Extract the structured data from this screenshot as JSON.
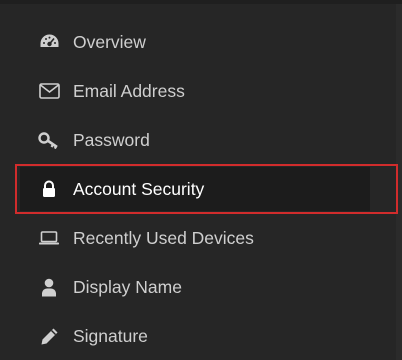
{
  "menu": {
    "items": [
      {
        "label": "Overview",
        "icon": "gauge-icon"
      },
      {
        "label": "Email Address",
        "icon": "envelope-icon"
      },
      {
        "label": "Password",
        "icon": "key-icon"
      },
      {
        "label": "Account Security",
        "icon": "lock-icon",
        "active": true
      },
      {
        "label": "Recently Used Devices",
        "icon": "laptop-icon"
      },
      {
        "label": "Display Name",
        "icon": "user-icon"
      },
      {
        "label": "Signature",
        "icon": "pencil-icon"
      }
    ]
  },
  "colors": {
    "background": "#262626",
    "active_background": "#1c1c1c",
    "text": "#cfcfcf",
    "active_text": "#ffffff",
    "highlight_border": "#d12c2c"
  }
}
